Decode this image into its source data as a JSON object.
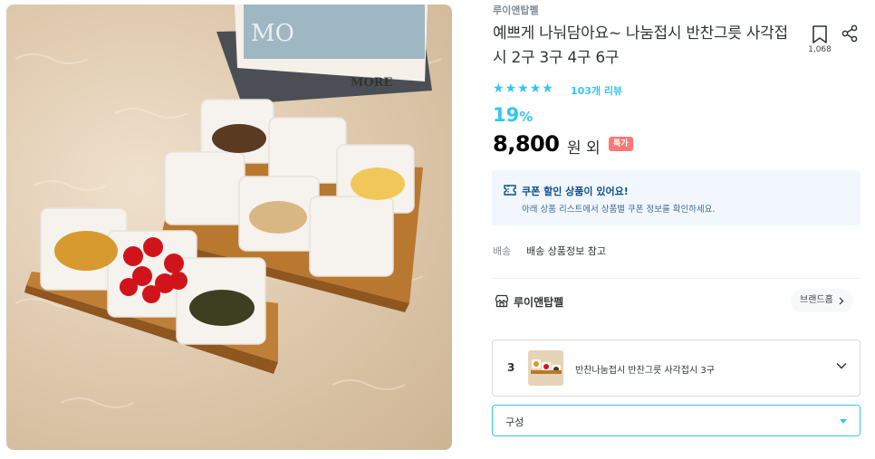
{
  "product": {
    "brand": "루이앤탑펠",
    "title": "예쁘게 나눠담아요~ 나눔접시 반찬그릇 사각접시 2구 3구 4구 6구",
    "scrap_count": "1,068",
    "rating_stars": 5,
    "review_text": "103개 리뷰",
    "discount_value": "19",
    "discount_unit": "%",
    "price": "8,800",
    "price_suffix": "원 외",
    "special_badge": "특가"
  },
  "coupon": {
    "title": "쿠폰 할인 상품이 있어요!",
    "description": "아래 상품 리스트에서 상품별 쿠폰 정보를 확인하세요.",
    "icon": "coupon-icon"
  },
  "shipping": {
    "label": "배송",
    "value": "배송 상품정보 참고"
  },
  "store": {
    "icon": "store-icon",
    "name": "루이앤탑펠",
    "brand_home_label": "브랜드홈"
  },
  "selected_option": {
    "quantity": "3",
    "name": "반찬나눔접시 반찬그릇 사각접시 3구"
  },
  "option_select": {
    "placeholder": "구성"
  },
  "icons": {
    "bookmark": "bookmark-icon",
    "share": "share-icon",
    "star": "star-icon",
    "chevron": "chevron-down-icon"
  },
  "colors": {
    "accent": "#35c5f0",
    "badge": "#ff7777",
    "coupon_bg": "#f1f7fd",
    "coupon_text": "#0d4e8a"
  }
}
